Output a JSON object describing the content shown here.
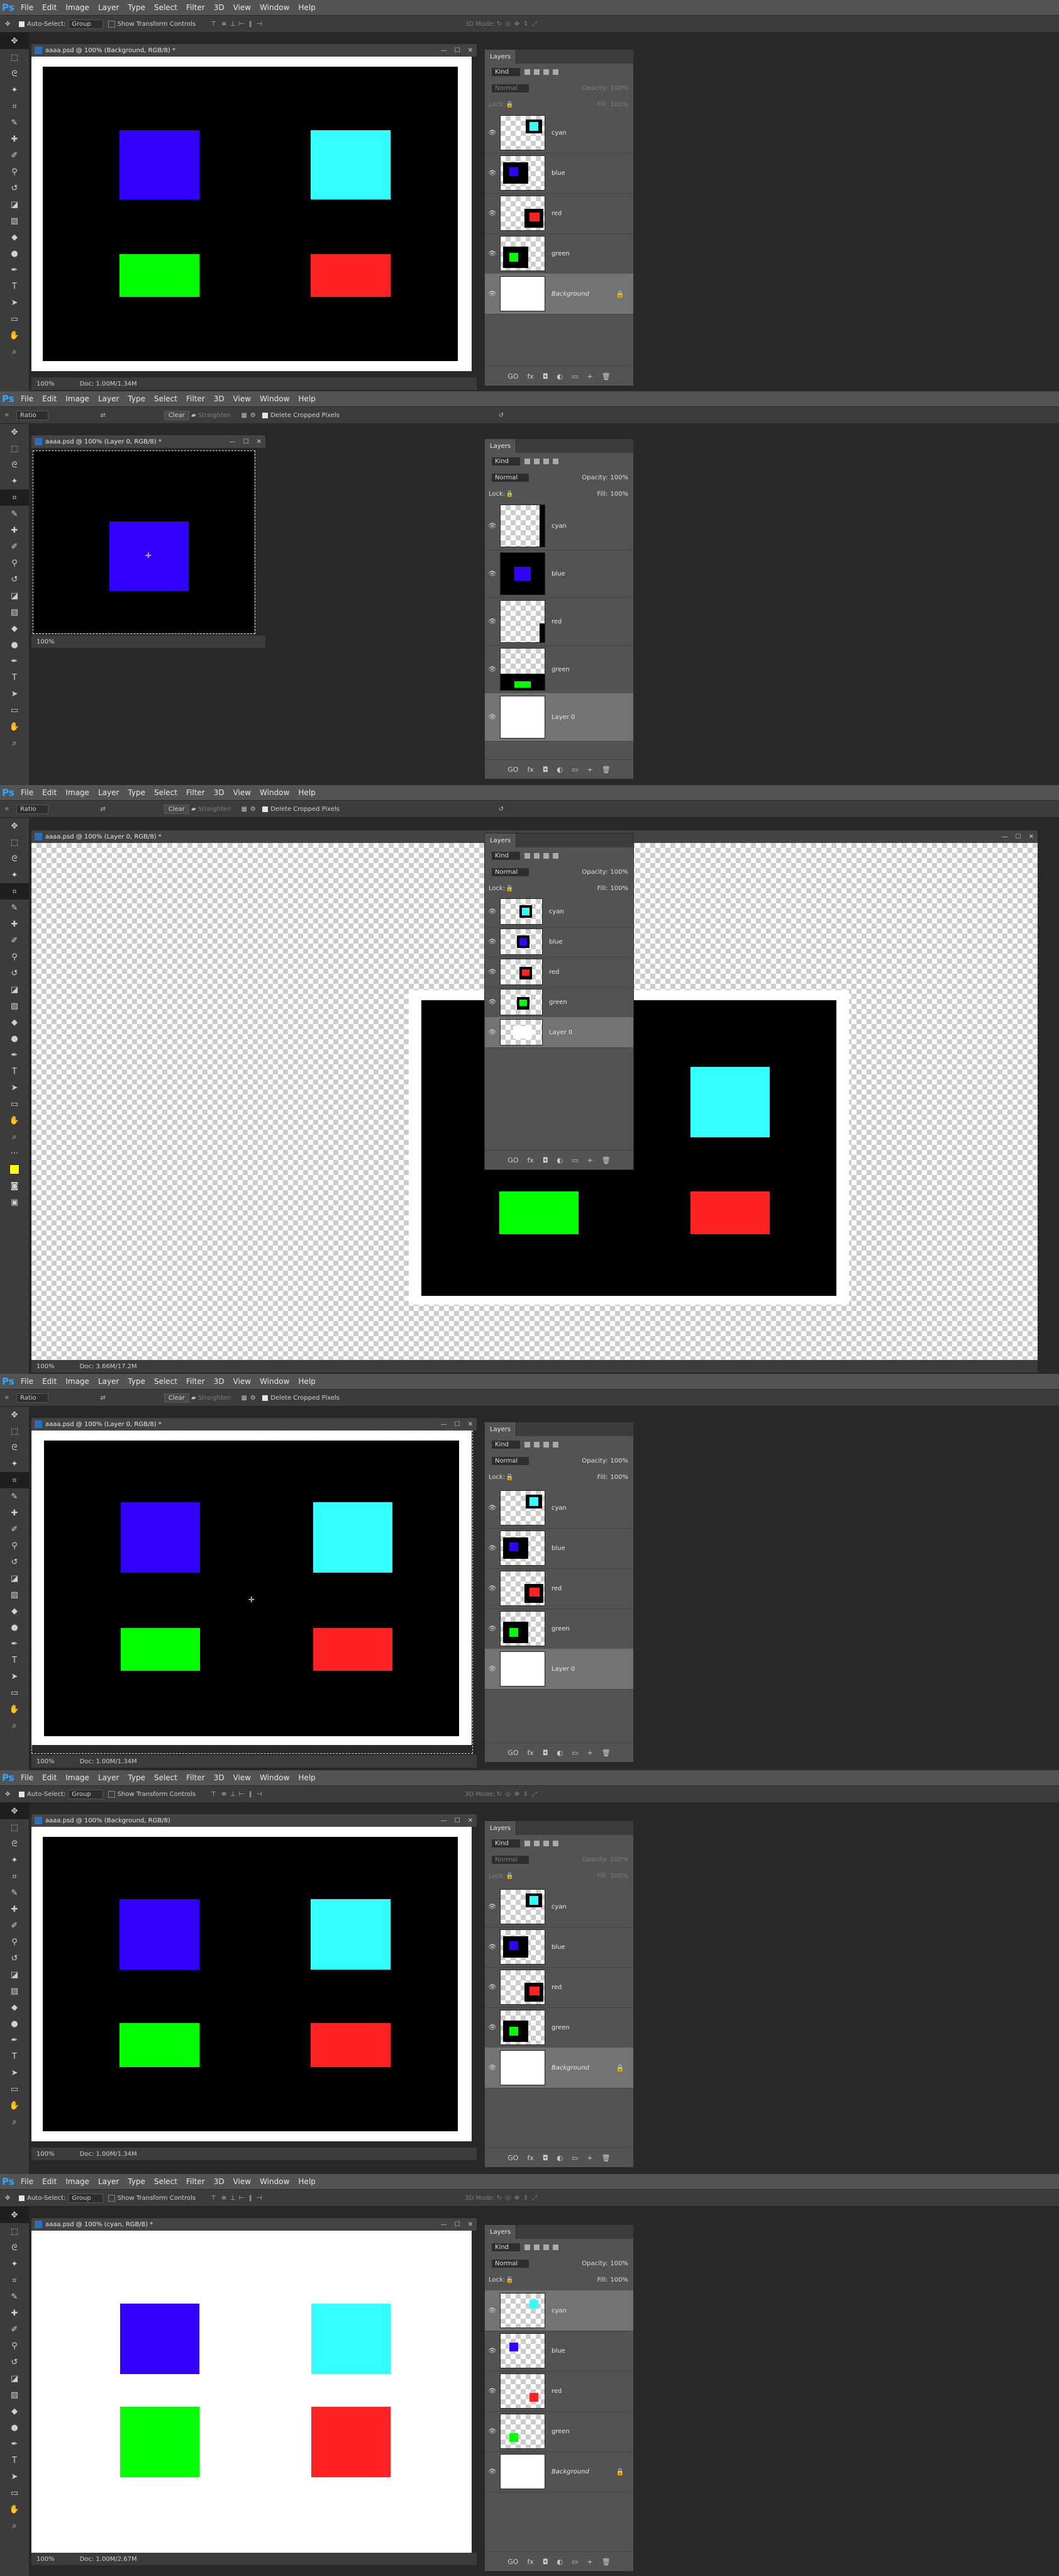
{
  "app": {
    "logo": "Ps"
  },
  "menu": [
    "File",
    "Edit",
    "Image",
    "Layer",
    "Type",
    "Select",
    "Filter",
    "3D",
    "View",
    "Window",
    "Help"
  ],
  "colors": {
    "blue": "#3300ff",
    "cyan": "#33ffff",
    "green": "#00ff00",
    "red": "#ff2222",
    "black": "#000000",
    "white": "#ffffff"
  },
  "move_options": {
    "auto_select": "Auto-Select:",
    "group": "Group",
    "show_transform": "Show Transform Controls",
    "mode3d": "3D Mode:"
  },
  "crop_options": {
    "ratio": "Ratio",
    "clear": "Clear",
    "straighten": "Straighten",
    "delete_cropped": "Delete Cropped Pixels"
  },
  "panel": {
    "title": "Layers",
    "kind": "Kind",
    "blend": "Normal",
    "opacity_label": "Opacity:",
    "opacity_value": "100%",
    "lock_label": "Lock:",
    "fill_label": "Fill:",
    "fill_value": "100%",
    "footer": [
      "GO",
      "fx",
      "◘",
      "◐",
      "▭",
      "+",
      "🗑"
    ]
  },
  "frames": [
    {
      "doc_title": "aaaa.psd @ 100% (Background, RGB/8) *",
      "zoom": "100%",
      "doc_info": "Doc: 1.00M/1.34M",
      "layers": [
        "cyan",
        "blue",
        "red",
        "green",
        "Background"
      ],
      "selected": 4
    },
    {
      "doc_title": "aaaa.psd @ 100% (Layer 0, RGB/8) *",
      "zoom": "100%",
      "doc_info": "",
      "layers": [
        "cyan",
        "blue",
        "red",
        "green",
        "Layer 0"
      ],
      "selected": 4
    },
    {
      "doc_title": "aaaa.psd @ 100% (Layer 0, RGB/8) *",
      "zoom": "100%",
      "doc_info": "Doc: 3.66M/17.2M",
      "layers": [
        "cyan",
        "blue",
        "red",
        "green",
        "Layer 0"
      ],
      "selected": 4
    },
    {
      "doc_title": "aaaa.psd @ 100% (Layer 0, RGB/8) *",
      "zoom": "100%",
      "doc_info": "Doc: 1.00M/1.34M",
      "layers": [
        "cyan",
        "blue",
        "red",
        "green",
        "Layer 0"
      ],
      "selected": 4
    },
    {
      "doc_title": "aaaa.psd @ 100% (Background, RGB/8)",
      "zoom": "100%",
      "doc_info": "Doc: 1.00M/1.34M",
      "layers": [
        "cyan",
        "blue",
        "red",
        "green",
        "Background"
      ],
      "selected": 4
    },
    {
      "doc_title": "aaaa.psd @ 100% (cyan, RGB/8) *",
      "zoom": "100%",
      "doc_info": "Doc: 1.00M/2.67M",
      "layers": [
        "cyan",
        "blue",
        "red",
        "green",
        "Background"
      ],
      "selected": 0
    }
  ]
}
